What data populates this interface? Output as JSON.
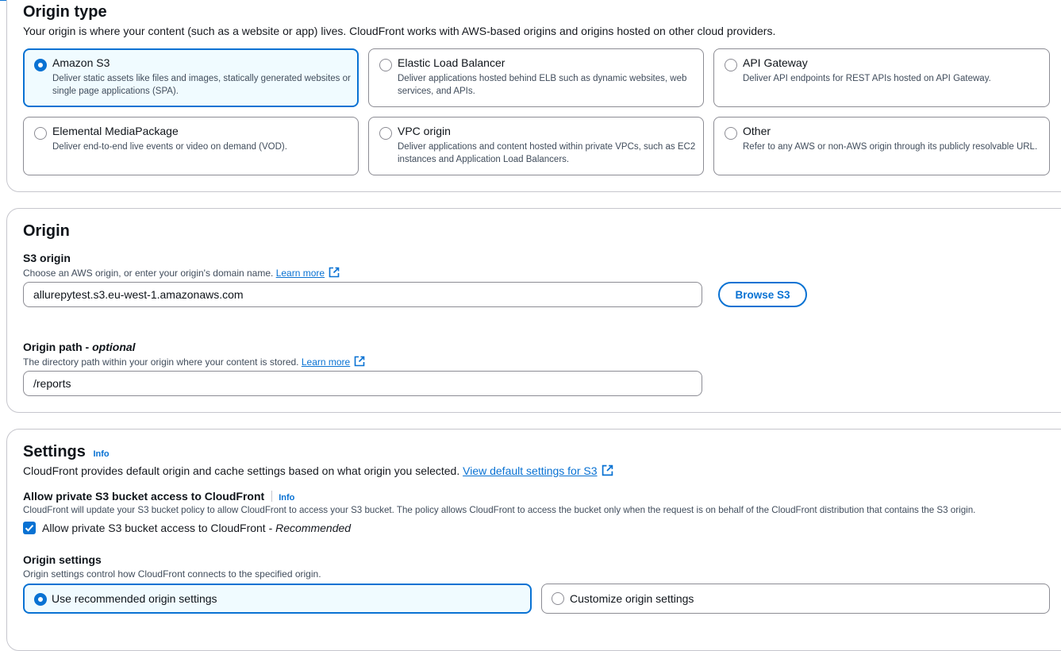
{
  "origin_type": {
    "title": "Origin type",
    "description": "Your origin is where your content (such as a website or app) lives. CloudFront works with AWS-based origins and origins hosted on other cloud providers.",
    "options": [
      {
        "title": "Amazon S3",
        "desc": "Deliver static assets like files and images, statically generated websites or single page applications (SPA).",
        "selected": true
      },
      {
        "title": "Elastic Load Balancer",
        "desc": "Deliver applications hosted behind ELB such as dynamic websites, web services, and APIs.",
        "selected": false
      },
      {
        "title": "API Gateway",
        "desc": "Deliver API endpoints for REST APIs hosted on API Gateway.",
        "selected": false
      },
      {
        "title": "Elemental MediaPackage",
        "desc": "Deliver end-to-end live events or video on demand (VOD).",
        "selected": false
      },
      {
        "title": "VPC origin",
        "desc": "Deliver applications and content hosted within private VPCs, such as EC2 instances and Application Load Balancers.",
        "selected": false
      },
      {
        "title": "Other",
        "desc": "Refer to any AWS or non-AWS origin through its publicly resolvable URL.",
        "selected": false
      }
    ]
  },
  "origin": {
    "title": "Origin",
    "s3_origin_label": "S3 origin",
    "s3_origin_desc": "Choose an AWS origin, or enter your origin's domain name.",
    "learn_more": "Learn more",
    "s3_origin_value": "allurepytest.s3.eu-west-1.amazonaws.com",
    "browse_button": "Browse S3",
    "path_label": "Origin path - ",
    "path_label_optional": "optional",
    "path_desc": "The directory path within your origin where your content is stored.",
    "path_value": "/reports"
  },
  "settings": {
    "title": "Settings",
    "info": "Info",
    "description": "CloudFront provides default origin and cache settings based on what origin you selected.",
    "view_defaults_link": "View default settings for S3",
    "private_access_label": "Allow private S3 bucket access to CloudFront",
    "private_access_desc": "CloudFront will update your S3 bucket policy to allow CloudFront to access your S3 bucket. The policy allows CloudFront to access the bucket only when the request is on behalf of the CloudFront distribution that contains the S3 origin.",
    "checkbox_label": "Allow private S3 bucket access to CloudFront - ",
    "checkbox_label_recommended": "Recommended",
    "checkbox_checked": true,
    "origin_settings_label": "Origin settings",
    "origin_settings_desc": "Origin settings control how CloudFront connects to the specified origin.",
    "origin_settings_options": [
      {
        "label": "Use recommended origin settings",
        "selected": true
      },
      {
        "label": "Customize origin settings",
        "selected": false
      }
    ]
  },
  "colors": {
    "accent": "#0972d3",
    "selected_bg": "#f0fbff",
    "border": "#8c8c94"
  },
  "icons": [
    "external-link-icon",
    "check-icon"
  ]
}
